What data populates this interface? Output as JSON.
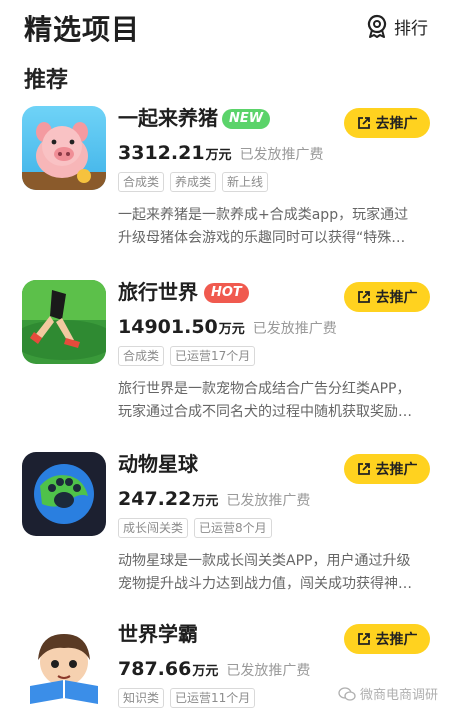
{
  "header": {
    "title": "精选项目",
    "rank_label": "排行",
    "rank_icon": "trophy-icon"
  },
  "section": {
    "title": "推荐"
  },
  "promote_label": "去推广",
  "colors": {
    "accent_yellow": "#ffd21f",
    "new_green": "#5bd36a",
    "hot_red": "#f05a4f"
  },
  "items": [
    {
      "name": "一起来养猪",
      "badge": "NEW",
      "fee_amount": "3312.21",
      "fee_unit": "万元",
      "fee_label": "已发放推广费",
      "tags": [
        "合成类",
        "养成类",
        "新上线"
      ],
      "desc_line1": "一起来养猪是一款养成+合成类app，玩家通过",
      "desc_line2": "升级母猪体会游戏的乐趣同时可以获得“特殊…",
      "icon": "pig-app-icon"
    },
    {
      "name": "旅行世界",
      "badge": "HOT",
      "fee_amount": "14901.50",
      "fee_unit": "万元",
      "fee_label": "已发放推广费",
      "tags": [
        "合成类",
        "已运营17个月"
      ],
      "desc_line1": "旅行世界是一款宠物合成结合广告分红类APP，",
      "desc_line2": "玩家通过合成不同名犬的过程中随机获取奖励…",
      "icon": "runner-app-icon"
    },
    {
      "name": "动物星球",
      "badge": "",
      "fee_amount": "247.22",
      "fee_unit": "万元",
      "fee_label": "已发放推广费",
      "tags": [
        "成长闯关类",
        "已运营8个月"
      ],
      "desc_line1": "动物星球是一款成长闯关类APP，用户通过升级",
      "desc_line2": "宠物提升战斗力达到战力值，闯关成功获得神…",
      "icon": "paw-planet-app-icon"
    },
    {
      "name": "世界学霸",
      "badge": "",
      "fee_amount": "787.66",
      "fee_unit": "万元",
      "fee_label": "已发放推广费",
      "tags": [
        "知识类",
        "已运营11个月"
      ],
      "desc_line1": "",
      "desc_line2": "",
      "icon": "student-app-icon"
    }
  ],
  "watermark": "微商电商调研"
}
